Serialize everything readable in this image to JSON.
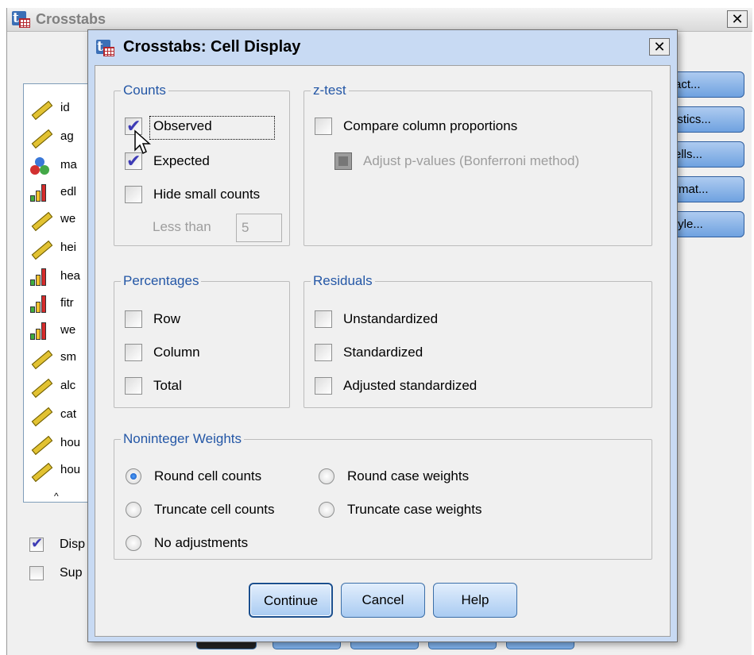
{
  "parent": {
    "title": "Crosstabs",
    "close_glyph": "✕",
    "variables": [
      {
        "label": "id",
        "icon": "scale-ruler-icon"
      },
      {
        "label": "ag",
        "icon": "scale-ruler-icon"
      },
      {
        "label": "ma",
        "icon": "nominal-circles-icon"
      },
      {
        "label": "edl",
        "icon": "ordinal-bars-icon"
      },
      {
        "label": "we",
        "icon": "scale-ruler-icon"
      },
      {
        "label": "hei",
        "icon": "scale-ruler-icon"
      },
      {
        "label": "hea",
        "icon": "ordinal-bars-icon"
      },
      {
        "label": "fitr",
        "icon": "ordinal-bars-icon"
      },
      {
        "label": "we",
        "icon": "ordinal-bars-icon"
      },
      {
        "label": "sm",
        "icon": "scale-ruler-icon"
      },
      {
        "label": "alc",
        "icon": "scale-ruler-icon"
      },
      {
        "label": "cat",
        "icon": "scale-ruler-icon"
      },
      {
        "label": "hou",
        "icon": "scale-ruler-icon"
      },
      {
        "label": "hou",
        "icon": "scale-ruler-icon"
      }
    ],
    "side_buttons": [
      "act...",
      "istics...",
      "ells...",
      "rmat...",
      "tyle..."
    ],
    "checks": [
      {
        "label": "Disp",
        "checked": true
      },
      {
        "label": "Sup",
        "checked": false
      }
    ]
  },
  "dialog": {
    "title": "Crosstabs: Cell Display",
    "close_glyph": "✕",
    "counts": {
      "legend": "Counts",
      "observed": "Observed",
      "expected": "Expected",
      "hide_small": "Hide small counts",
      "less_than": "Less than",
      "less_than_value": "5"
    },
    "ztest": {
      "legend": "z-test",
      "compare": "Compare column proportions",
      "adjust": "Adjust p-values (Bonferroni method)"
    },
    "percentages": {
      "legend": "Percentages",
      "row": "Row",
      "column": "Column",
      "total": "Total"
    },
    "residuals": {
      "legend": "Residuals",
      "unstandardized": "Unstandardized",
      "standardized": "Standardized",
      "adjusted": "Adjusted standardized"
    },
    "weights": {
      "legend": "Noninteger Weights",
      "round_cell": "Round cell counts",
      "round_case": "Round case weights",
      "truncate_cell": "Truncate cell counts",
      "truncate_case": "Truncate case weights",
      "none": "No adjustments",
      "selected": "Round cell counts"
    },
    "buttons": {
      "continue": "Continue",
      "cancel": "Cancel",
      "help": "Help"
    }
  },
  "colors": {
    "group_label": "#2457a6",
    "button_fill": "#a9cbf2",
    "dialog_frame": "#c8daf3",
    "checkmark": "#3d3bb5"
  }
}
